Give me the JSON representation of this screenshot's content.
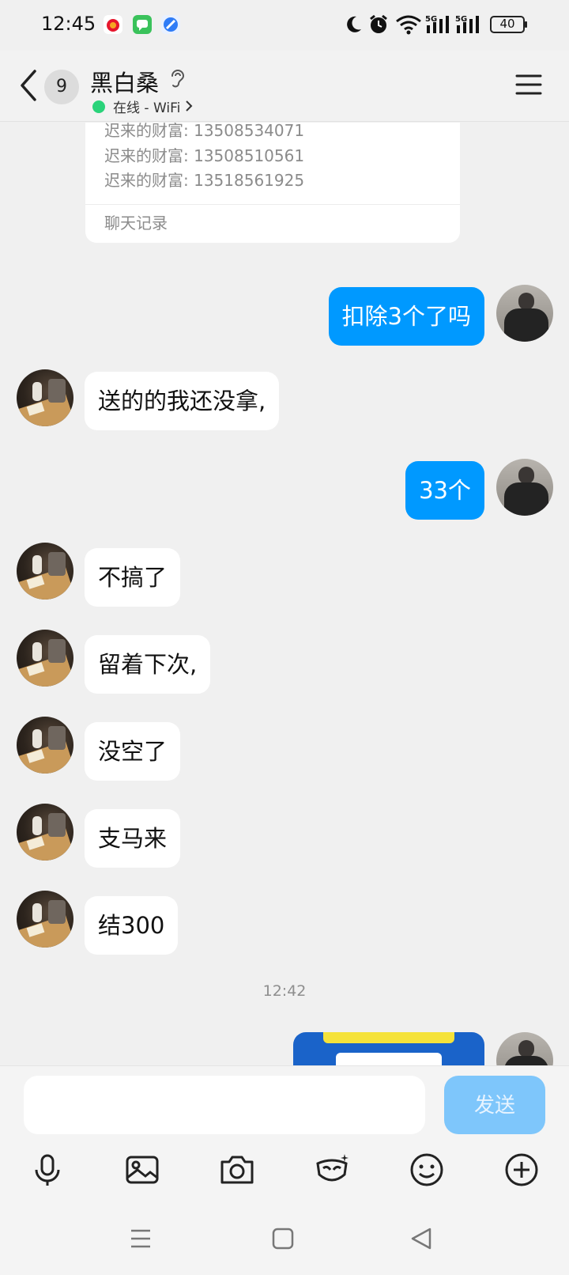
{
  "status_bar": {
    "time": "12:45",
    "battery": "40",
    "icons": [
      "weibo-icon",
      "messages-icon",
      "browser-icon",
      "moon-icon",
      "alarm-icon",
      "wifi-icon",
      "signal-5g-icon",
      "signal-5g-icon",
      "battery-icon"
    ]
  },
  "header": {
    "unread_count": "9",
    "contact_name": "黑白桑",
    "online_status": "在线 - WiFi"
  },
  "record_card": {
    "lines": [
      "迟来的财富: 13508534071",
      "迟来的财富: 13508510561",
      "迟来的财富: 13518561925"
    ],
    "footer": "聊天记录"
  },
  "messages": [
    {
      "side": "out",
      "text": "扣除3个了吗"
    },
    {
      "side": "in",
      "text": "送的的我还没拿,"
    },
    {
      "side": "out",
      "text": "33个"
    },
    {
      "side": "in",
      "text": "不搞了"
    },
    {
      "side": "in",
      "text": "留着下次,"
    },
    {
      "side": "in",
      "text": "没空了"
    },
    {
      "side": "in",
      "text": "支马来"
    },
    {
      "side": "in",
      "text": "结300"
    }
  ],
  "time_separator": "12:42",
  "input": {
    "placeholder": "",
    "send_label": "发送"
  },
  "toolbar": [
    "microphone-icon",
    "image-icon",
    "camera-icon",
    "face-mask-icon",
    "emoji-icon",
    "plus-icon"
  ],
  "colors": {
    "outgoing_bubble": "#0099ff",
    "incoming_bubble": "#ffffff",
    "send_button_disabled": "#7ec6fb",
    "online": "#2ad37a"
  }
}
